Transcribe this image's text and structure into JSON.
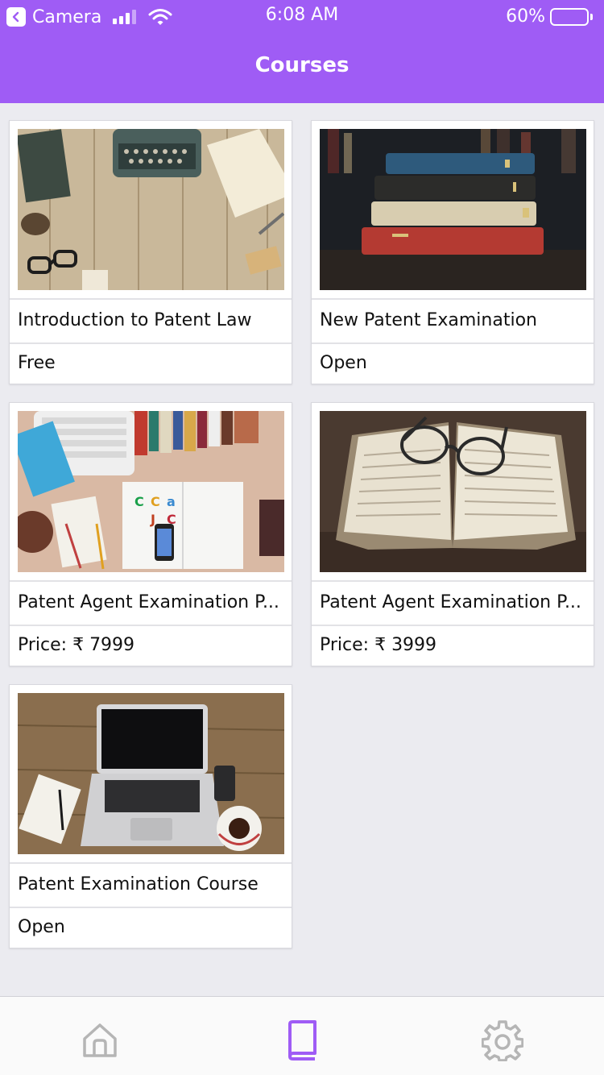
{
  "status_bar": {
    "back_app": "Camera",
    "time": "6:08 AM",
    "battery": "60%",
    "battery_level": 0.6
  },
  "header": {
    "title": "Courses"
  },
  "courses": [
    {
      "name": "Introduction to Patent Law",
      "price": "Free",
      "image": "desk-typewriter-image"
    },
    {
      "name": "New Patent Examination",
      "price": "Open",
      "image": "book-stack-image"
    },
    {
      "name": "Patent Agent Examination P...",
      "price": "Price: ₹ 7999",
      "image": "desk-magazine-image"
    },
    {
      "name": "Patent Agent Examination P...",
      "price": "Price: ₹ 3999",
      "image": "open-book-glasses-image"
    },
    {
      "name": "Patent Examination Course",
      "price": "Open",
      "image": "laptop-desk-image"
    }
  ],
  "tabbar": {
    "tabs": [
      {
        "icon": "home-icon",
        "active": false
      },
      {
        "icon": "book-icon",
        "active": true
      },
      {
        "icon": "gear-icon",
        "active": false
      }
    ],
    "active_color": "#9f5cf5",
    "inactive_color": "#b5b5b5"
  },
  "colors": {
    "accent": "#9f5cf5",
    "background": "#ebebf0"
  }
}
